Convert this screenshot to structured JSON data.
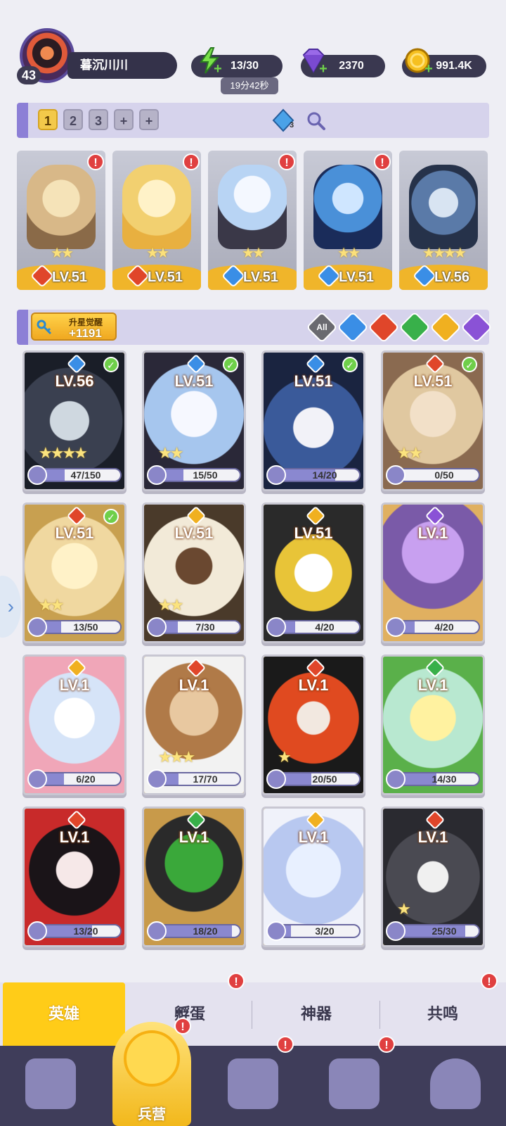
{
  "player": {
    "level": "43",
    "name": "暮沉川川"
  },
  "resources": {
    "energy": "13/30",
    "energy_timer": "19分42秒",
    "gems": "2370",
    "gold": "991.4K"
  },
  "teams": {
    "tabs": [
      "1",
      "2",
      "3",
      "+",
      "+"
    ],
    "active": "1",
    "crystal_count": "3"
  },
  "lineup": [
    {
      "level": "LV.51",
      "stars": "★★",
      "element": "fire",
      "alert": "!"
    },
    {
      "level": "LV.51",
      "stars": "★★",
      "element": "fire",
      "alert": "!"
    },
    {
      "level": "LV.51",
      "stars": "★★",
      "element": "water",
      "alert": "!"
    },
    {
      "level": "LV.51",
      "stars": "★★",
      "element": "water",
      "alert": "!"
    },
    {
      "level": "LV.56",
      "stars": "★★★★",
      "element": "water",
      "alert": ""
    }
  ],
  "filter": {
    "awaken_label": "升星觉醒",
    "awaken_value": "+1191",
    "all_label": "All",
    "elements": [
      "water",
      "fire",
      "nature",
      "light",
      "dark"
    ]
  },
  "heroes": [
    {
      "level": "LV.56",
      "element": "water",
      "checked": true,
      "stars": "★★★★",
      "progress": "47/150",
      "ratio": 0.31
    },
    {
      "level": "LV.51",
      "element": "water",
      "checked": true,
      "stars": "★★",
      "progress": "15/50",
      "ratio": 0.3
    },
    {
      "level": "LV.51",
      "element": "water",
      "checked": true,
      "stars": "",
      "progress": "14/20",
      "ratio": 0.7
    },
    {
      "level": "LV.51",
      "element": "fire",
      "checked": true,
      "stars": "★★",
      "progress": "0/50",
      "ratio": 0.0
    },
    {
      "level": "LV.51",
      "element": "fire",
      "checked": true,
      "stars": "★★",
      "progress": "13/50",
      "ratio": 0.26
    },
    {
      "level": "LV.51",
      "element": "light",
      "checked": false,
      "stars": "★★",
      "progress": "7/30",
      "ratio": 0.23
    },
    {
      "level": "LV.51",
      "element": "light",
      "checked": false,
      "stars": "",
      "progress": "4/20",
      "ratio": 0.2
    },
    {
      "level": "LV.1",
      "element": "dark",
      "checked": false,
      "stars": "",
      "progress": "4/20",
      "ratio": 0.2
    },
    {
      "level": "LV.1",
      "element": "light",
      "checked": false,
      "stars": "",
      "progress": "6/20",
      "ratio": 0.3
    },
    {
      "level": "LV.1",
      "element": "fire",
      "checked": false,
      "stars": "★★★",
      "progress": "17/70",
      "ratio": 0.24
    },
    {
      "level": "LV.1",
      "element": "fire",
      "checked": false,
      "stars": "★",
      "progress": "20/50",
      "ratio": 0.4
    },
    {
      "level": "LV.1",
      "element": "nature",
      "checked": false,
      "stars": "",
      "progress": "14/30",
      "ratio": 0.47
    },
    {
      "level": "LV.1",
      "element": "fire",
      "checked": false,
      "stars": "",
      "progress": "13/20",
      "ratio": 0.65
    },
    {
      "level": "LV.1",
      "element": "nature",
      "checked": false,
      "stars": "",
      "progress": "18/20",
      "ratio": 0.9
    },
    {
      "level": "LV.1",
      "element": "light",
      "checked": false,
      "stars": "",
      "progress": "3/20",
      "ratio": 0.15
    },
    {
      "level": "LV.1",
      "element": "fire",
      "checked": false,
      "stars": "★",
      "progress": "25/30",
      "ratio": 0.83
    }
  ],
  "subtabs": {
    "heroes": "英雄",
    "hatch": "孵蛋",
    "artifact": "神器",
    "resonance": "共鸣",
    "alert": "!"
  },
  "nav": {
    "barracks": "兵营",
    "alert": "!"
  },
  "colors": {
    "water": "#3a8ee6",
    "fire": "#e0462a",
    "nature": "#38b04a",
    "light": "#f0b020",
    "dark": "#8a52d6",
    "accent": "#ffcc18"
  }
}
